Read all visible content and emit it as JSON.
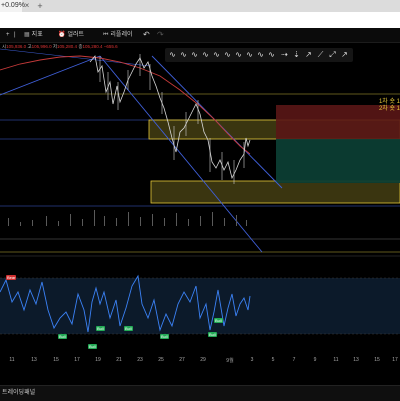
{
  "browser": {
    "tab_label": "+0.09%",
    "close_glyph": "×",
    "new_tab_glyph": "+"
  },
  "toolbar": {
    "add_icon": "plus-icon",
    "indicator_label": "지표",
    "alert_label": "얼러트",
    "replay_label": "리플레이",
    "undo_glyph": "↶",
    "redo_glyph": "↷"
  },
  "ohlc": {
    "o_label": "시",
    "o_value": "105,936.0",
    "h_label": "고",
    "h_value": "105,996.0",
    "l_label": "저",
    "l_value": "105,280.4",
    "c_label": "종",
    "c_value": "105,280.4",
    "change": "−655.6"
  },
  "drawing_tools": [
    "∿",
    "∿",
    "∿",
    "∿",
    "∿",
    "∿",
    "∿",
    "∿",
    "∿",
    "∿",
    "⇢",
    "⇣",
    "↗",
    "⟋",
    "⤢",
    "↗"
  ],
  "labels": {
    "first_target": "1차 숏 1",
    "second_target": "2차 숏 1"
  },
  "x_axis_ticks": [
    "11",
    "13",
    "15",
    "17",
    "19",
    "21",
    "23",
    "25",
    "27",
    "29",
    "9월",
    "3",
    "5",
    "7",
    "9",
    "11",
    "13",
    "15",
    "17"
  ],
  "rsi_tags": [
    "Bear",
    "Bull",
    "Bull",
    "Bull",
    "Bull",
    "Bull",
    "Bull",
    "Bull"
  ],
  "bottom": {
    "channel_label": "트레이딩패널"
  },
  "colors": {
    "channel_line": "#3f5fd8",
    "zone_fill": "#4a4510",
    "zone_border": "#e5c93a",
    "price_line": "#d0d0d0",
    "rsi_line": "#3b82f6",
    "short_red": "#7a1a1a",
    "short_green": "#0e4a3e"
  }
}
